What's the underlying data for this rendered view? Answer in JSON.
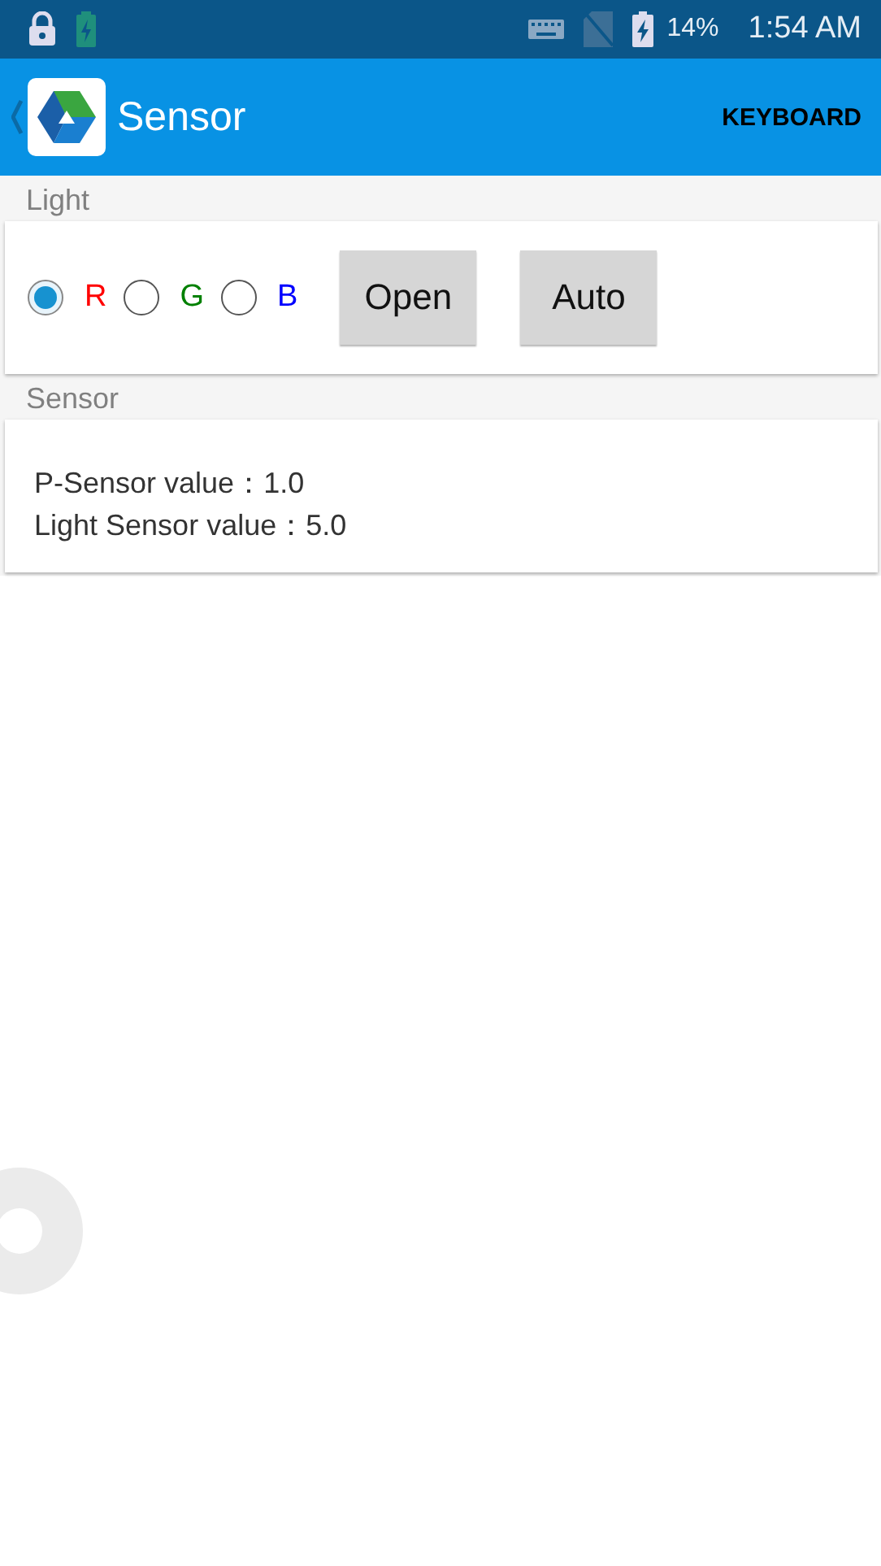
{
  "status_bar": {
    "battery": "14%",
    "time": "1:54 AM"
  },
  "app_bar": {
    "title": "Sensor",
    "action": "KEYBOARD"
  },
  "light": {
    "heading": "Light",
    "options": [
      {
        "label": "R",
        "color": "#ff0000",
        "selected": true
      },
      {
        "label": "G",
        "color": "#008000",
        "selected": false
      },
      {
        "label": "B",
        "color": "#0000ff",
        "selected": false
      }
    ],
    "buttons": [
      "Open",
      "Auto"
    ]
  },
  "sensor": {
    "heading": "Sensor",
    "readings": [
      "P-Sensor value：1.0",
      "Light Sensor value：5.0"
    ]
  }
}
